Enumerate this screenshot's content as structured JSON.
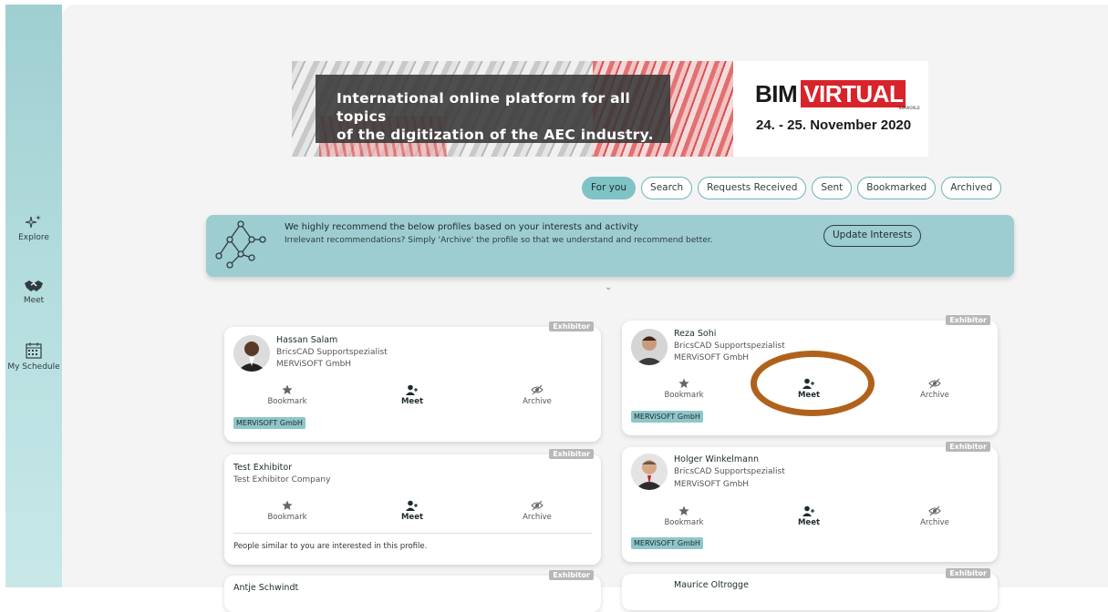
{
  "sidebar": {
    "items": [
      {
        "label": "Explore",
        "icon": "sparkles-icon"
      },
      {
        "label": "Meet",
        "icon": "handshake-icon"
      },
      {
        "label": "My Schedule",
        "icon": "calendar-icon"
      }
    ]
  },
  "banner": {
    "line1": "International online platform for all topics",
    "line2": "of the digitization of the AEC industry.",
    "brand_bim": "BIM",
    "brand_virtual": "VIRTUAL",
    "brand_sub": "*BIMWORLD",
    "dates": "24. - 25. November 2020"
  },
  "tabs": [
    "For you",
    "Search",
    "Requests Received",
    "Sent",
    "Bookmarked",
    "Archived"
  ],
  "recommendation": {
    "title": "We highly recommend the below profiles based on your interests and activity",
    "subtitle": "Irrelevant recommendations? Simply 'Archive' the profile so that we understand and recommend better.",
    "button": "Update Interests"
  },
  "actions": {
    "bookmark": "Bookmark",
    "meet": "Meet",
    "archive": "Archive"
  },
  "badge": "Exhibitor",
  "profiles": [
    {
      "name": "Hassan Salam",
      "role": "BricsCAD Supportspezialist",
      "company": "MERViSOFT GmbH",
      "tag": "MERViSOFT GmbH"
    },
    {
      "name": "Reza Sohi",
      "role": "BricsCAD Supportspezialist",
      "company": "MERViSOFT GmbH",
      "tag": "MERViSOFT GmbH"
    },
    {
      "name": "Test Exhibitor",
      "company": "Test Exhibitor Company",
      "hint": "People similar to you are interested in this profile."
    },
    {
      "name": "Holger Winkelmann",
      "role": "BricsCAD Supportspezialist",
      "company": "MERViSOFT GmbH",
      "tag": "MERViSOFT GmbH"
    },
    {
      "name": "Antje Schwindt"
    },
    {
      "name": "Maurice Oltrogge"
    }
  ],
  "colors": {
    "accent": "#7fc3c6",
    "highlight_ring": "#b0621c",
    "brand_red": "#d8232a"
  }
}
